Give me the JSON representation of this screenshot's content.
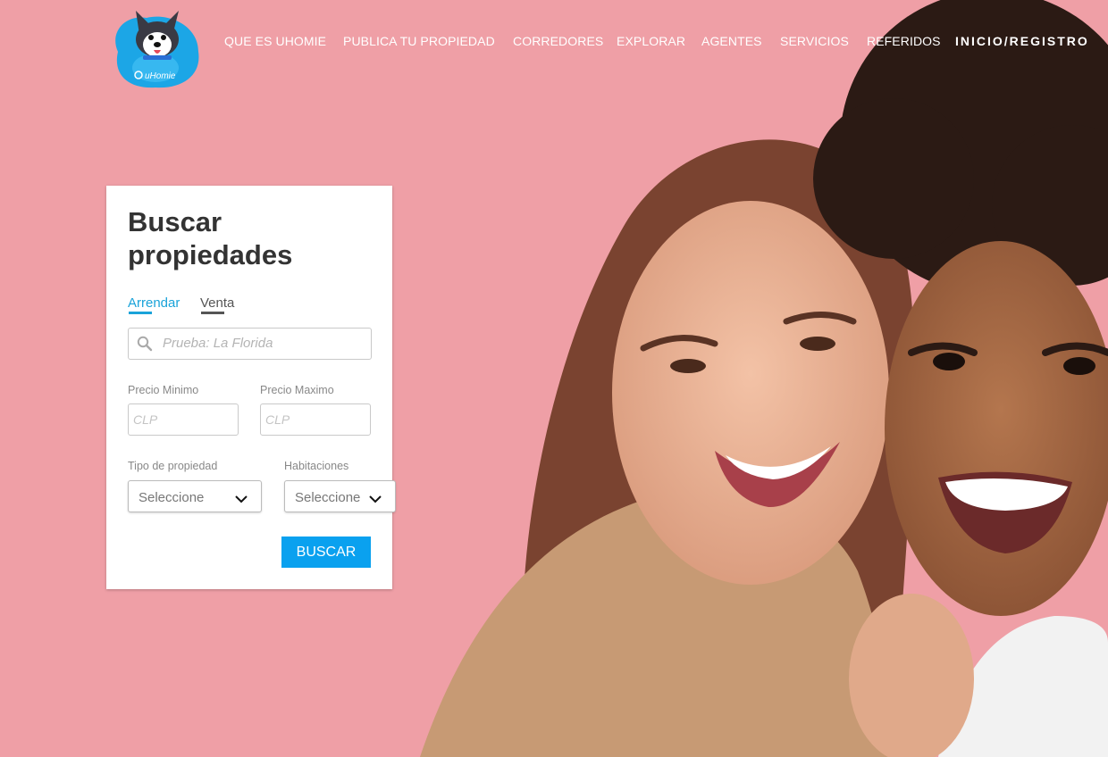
{
  "brand": {
    "name": "uHomie"
  },
  "nav": {
    "items": [
      {
        "label": "QUE ES UHOMIE"
      },
      {
        "label": "PUBLICA TU PROPIEDAD"
      },
      {
        "label": "CORREDORES"
      },
      {
        "label": "EXPLORAR"
      },
      {
        "label": "AGENTES"
      },
      {
        "label": "SERVICIOS"
      },
      {
        "label": "REFERIDOS"
      }
    ],
    "login_label": "INICIO/REGISTRO"
  },
  "search_card": {
    "title": "Buscar propiedades",
    "tabs": [
      {
        "label": "Arrendar",
        "active": true
      },
      {
        "label": "Venta",
        "active": false
      }
    ],
    "location_placeholder": "Prueba: La Florida",
    "price_min": {
      "label": "Precio Minimo",
      "placeholder": "CLP"
    },
    "price_max": {
      "label": "Precio Maximo",
      "placeholder": "CLP"
    },
    "property_type": {
      "label": "Tipo de propiedad",
      "value": "Seleccione"
    },
    "rooms": {
      "label": "Habitaciones",
      "value": "Seleccione"
    },
    "submit_label": "BUSCAR"
  },
  "colors": {
    "background": "#ef9fa6",
    "accent": "#0aa1ef",
    "tab_active": "#1aa3d9",
    "logo_blue": "#1ca6e6"
  }
}
